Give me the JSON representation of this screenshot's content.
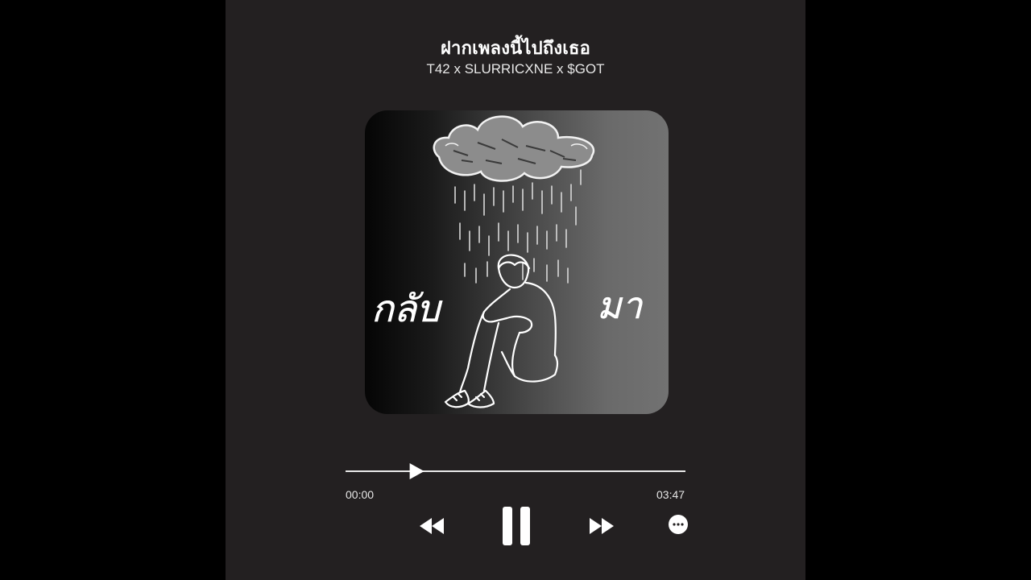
{
  "track": {
    "title": "ฝากเพลงนี้ไปถึงเธอ",
    "artists": "T42 x SLURRICXNE x $GOT",
    "cover_text_left": "กลับ",
    "cover_text_right": "มา"
  },
  "playback": {
    "current_time": "00:00",
    "duration": "03:47",
    "progress": 0.21
  },
  "controls": {
    "previous": "rewind-icon",
    "play_pause": "pause-icon",
    "next": "fast-forward-icon",
    "more": "more-options-icon"
  },
  "colors": {
    "background": "#000000",
    "panel": "#232021",
    "foreground": "#ffffff"
  }
}
